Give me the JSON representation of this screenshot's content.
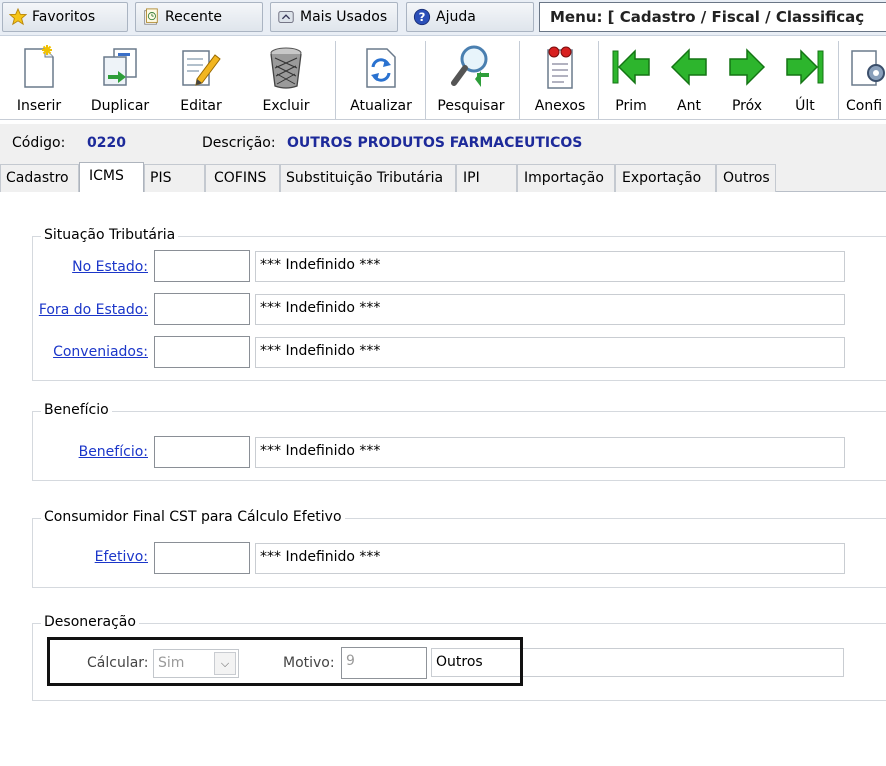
{
  "menubar": {
    "favoritos": "Favoritos",
    "recente": "Recente",
    "mais_usados": "Mais Usados",
    "ajuda": "Ajuda",
    "menu_path": "Menu: [ Cadastro / Fiscal / Classificaç"
  },
  "toolbar": {
    "inserir": "Inserir",
    "duplicar": "Duplicar",
    "editar": "Editar",
    "excluir": "Excluir",
    "atualizar": "Atualizar",
    "pesquisar": "Pesquisar",
    "anexos": "Anexos",
    "prim": "Prim",
    "ant": "Ant",
    "prox": "Próx",
    "ult": "Últ",
    "config": "Confi"
  },
  "record": {
    "codigo_label": "Código:",
    "codigo_value": "0220",
    "descricao_label": "Descrição:",
    "descricao_value": "OUTROS PRODUTOS FARMACEUTICOS"
  },
  "tabs": [
    "Cadastro",
    "ICMS",
    "PIS",
    "COFINS",
    "Substituição Tributária",
    "IPI",
    "Importação",
    "Exportação",
    "Outros"
  ],
  "situacao": {
    "title": "Situação Tributária",
    "no_estado": {
      "label": "No Estado:",
      "code": "",
      "desc": "*** Indefinido ***"
    },
    "fora_estado": {
      "label": "Fora do Estado:",
      "code": "",
      "desc": "*** Indefinido ***"
    },
    "conveniados": {
      "label": "Conveniados:",
      "code": "",
      "desc": "*** Indefinido ***"
    }
  },
  "beneficio": {
    "title": "Benefício",
    "field": {
      "label": "Benefício:",
      "code": "",
      "desc": "*** Indefinido ***"
    }
  },
  "consumidor": {
    "title": "Consumidor Final CST para Cálculo Efetivo",
    "field": {
      "label": "Efetivo:",
      "code": "",
      "desc": "*** Indefinido ***"
    }
  },
  "desoneracao": {
    "title": "Desoneração",
    "calcular_label": "Cálcular:",
    "calcular_value": "Sim",
    "motivo_label": "Motivo:",
    "motivo_code": "9",
    "motivo_desc": "Outros"
  },
  "colors": {
    "link": "#1b36c9",
    "value_blue": "#1d2a9a",
    "nav_green": "#2db52d"
  }
}
